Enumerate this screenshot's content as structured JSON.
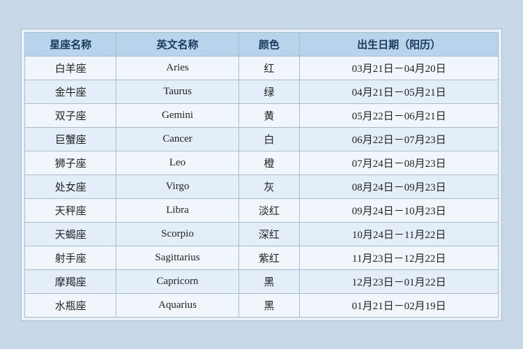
{
  "table": {
    "headers": {
      "chinese_name": "星座名称",
      "english_name": "英文名称",
      "color": "颜色",
      "birthdate": "出生日期（阳历）"
    },
    "rows": [
      {
        "chinese": "白羊座",
        "english": "Aries",
        "color": "红",
        "date": "03月21日－04月20日"
      },
      {
        "chinese": "金牛座",
        "english": "Taurus",
        "color": "绿",
        "date": "04月21日－05月21日"
      },
      {
        "chinese": "双子座",
        "english": "Gemini",
        "color": "黄",
        "date": "05月22日－06月21日"
      },
      {
        "chinese": "巨蟹座",
        "english": "Cancer",
        "color": "白",
        "date": "06月22日－07月23日"
      },
      {
        "chinese": "狮子座",
        "english": "Leo",
        "color": "橙",
        "date": "07月24日－08月23日"
      },
      {
        "chinese": "处女座",
        "english": "Virgo",
        "color": "灰",
        "date": "08月24日－09月23日"
      },
      {
        "chinese": "天秤座",
        "english": "Libra",
        "color": "淡红",
        "date": "09月24日－10月23日"
      },
      {
        "chinese": "天蝎座",
        "english": "Scorpio",
        "color": "深红",
        "date": "10月24日－11月22日"
      },
      {
        "chinese": "射手座",
        "english": "Sagittarius",
        "color": "紫红",
        "date": "11月23日－12月22日"
      },
      {
        "chinese": "摩羯座",
        "english": "Capricorn",
        "color": "黑",
        "date": "12月23日－01月22日"
      },
      {
        "chinese": "水瓶座",
        "english": "Aquarius",
        "color": "黑",
        "date": "01月21日－02月19日"
      }
    ]
  }
}
